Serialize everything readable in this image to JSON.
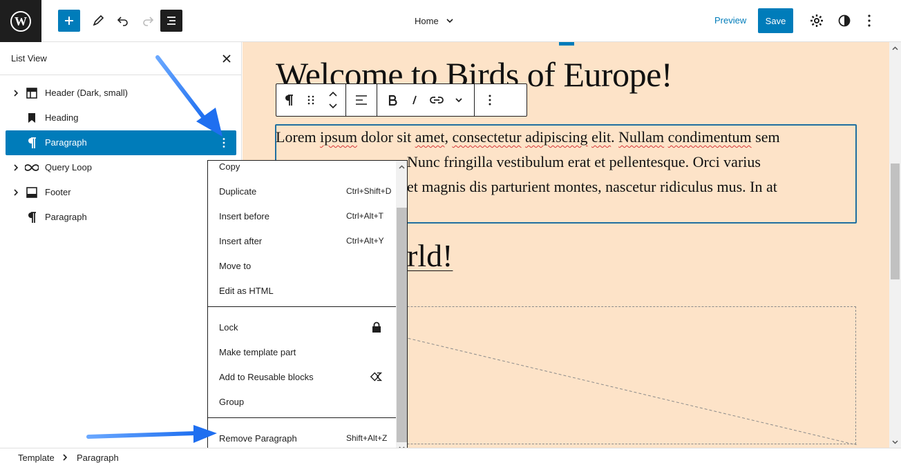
{
  "topbar": {
    "document_title": "Home",
    "preview_label": "Preview",
    "save_label": "Save"
  },
  "list_view": {
    "title": "List View",
    "items": [
      {
        "label": "Header (Dark, small)",
        "icon": "template-part-icon",
        "expandable": true,
        "selected": false
      },
      {
        "label": "Heading",
        "icon": "bookmark-icon",
        "expandable": false,
        "selected": false
      },
      {
        "label": "Paragraph",
        "icon": "pilcrow-icon",
        "expandable": false,
        "selected": true
      },
      {
        "label": "Query Loop",
        "icon": "loop-icon",
        "expandable": true,
        "selected": false
      },
      {
        "label": "Footer",
        "icon": "footer-icon",
        "expandable": true,
        "selected": false
      },
      {
        "label": "Paragraph",
        "icon": "pilcrow-icon",
        "expandable": false,
        "selected": false
      }
    ]
  },
  "canvas": {
    "heading": "Welcome to Birds of Europe!",
    "heading2_partial": "rld!",
    "paragraph": [
      {
        "text": "Lorem",
        "sq": false
      },
      {
        "text": " ",
        "sq": false
      },
      {
        "text": "ipsum",
        "sq": true
      },
      {
        "text": " dolor sit ",
        "sq": false
      },
      {
        "text": "amet",
        "sq": true
      },
      {
        "text": ", ",
        "sq": false
      },
      {
        "text": "consectetur",
        "sq": true
      },
      {
        "text": " ",
        "sq": false
      },
      {
        "text": "adipiscing",
        "sq": true
      },
      {
        "text": " ",
        "sq": false
      },
      {
        "text": "elit",
        "sq": true
      },
      {
        "text": ". ",
        "sq": false
      },
      {
        "text": "Nullam",
        "sq": true
      },
      {
        "text": " ",
        "sq": false
      },
      {
        "text": "condimentum",
        "sq": true
      },
      {
        "text": " sem",
        "sq": false
      }
    ],
    "paragraph_line2_visible": "Nunc fringilla vestibulum erat et pellentesque. Orci varius",
    "paragraph_line3_visible": "et magnis dis parturient montes, nascetur ridiculus mus. In at"
  },
  "context_menu": {
    "group1": [
      {
        "label": "Copy",
        "shortcut": ""
      },
      {
        "label": "Duplicate",
        "shortcut": "Ctrl+Shift+D"
      },
      {
        "label": "Insert before",
        "shortcut": "Ctrl+Alt+T"
      },
      {
        "label": "Insert after",
        "shortcut": "Ctrl+Alt+Y"
      },
      {
        "label": "Move to",
        "shortcut": ""
      },
      {
        "label": "Edit as HTML",
        "shortcut": ""
      }
    ],
    "group2": [
      {
        "label": "Lock",
        "icon": "lock-icon"
      },
      {
        "label": "Make template part",
        "icon": ""
      },
      {
        "label": "Add to Reusable blocks",
        "icon": "reusable-block-icon"
      },
      {
        "label": "Group",
        "icon": ""
      }
    ],
    "group3": [
      {
        "label": "Remove Paragraph",
        "shortcut": "Shift+Alt+Z"
      }
    ]
  },
  "breadcrumb": {
    "items": [
      "Template",
      "Paragraph"
    ]
  },
  "colors": {
    "accent": "#007cba",
    "canvas_bg": "#fde3c8",
    "annotation_arrow": "#2f7ff2"
  }
}
